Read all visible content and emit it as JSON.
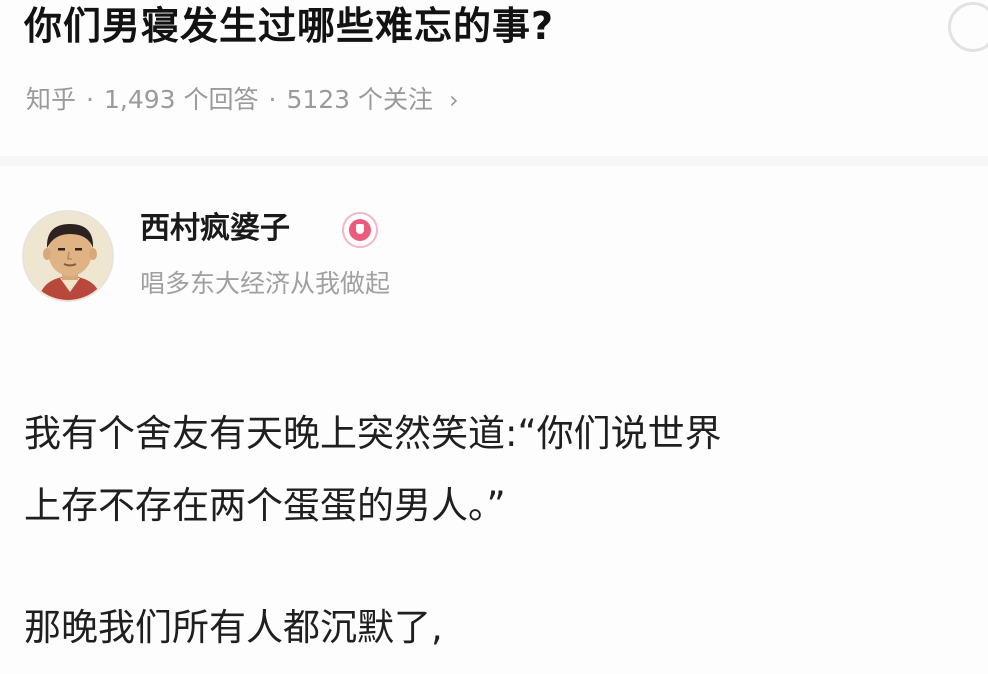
{
  "question": {
    "title": "你们男寝发生过哪些难忘的事?",
    "meta": {
      "source": "知乎",
      "answers": "1,493 个回答",
      "followers": "5123 个关注",
      "separator": "·",
      "chevron": "›"
    }
  },
  "author": {
    "name": "西村疯婆子",
    "bio": "唱多东大经济从我做起",
    "badge_icon": "certified-badge-icon",
    "avatar_icon": "cartoon-avatar-icon"
  },
  "answer": {
    "lines": [
      "我有个舍友有天晚上突然笑道:“你们说世界",
      "上存不存在两个蛋蛋的男人。”",
      "那晚我们所有人都沉默了,"
    ]
  },
  "colors": {
    "title": "#121212",
    "meta": "#9a9a9a",
    "badge": "#ec5b7e",
    "background": "#fdfdfd"
  }
}
